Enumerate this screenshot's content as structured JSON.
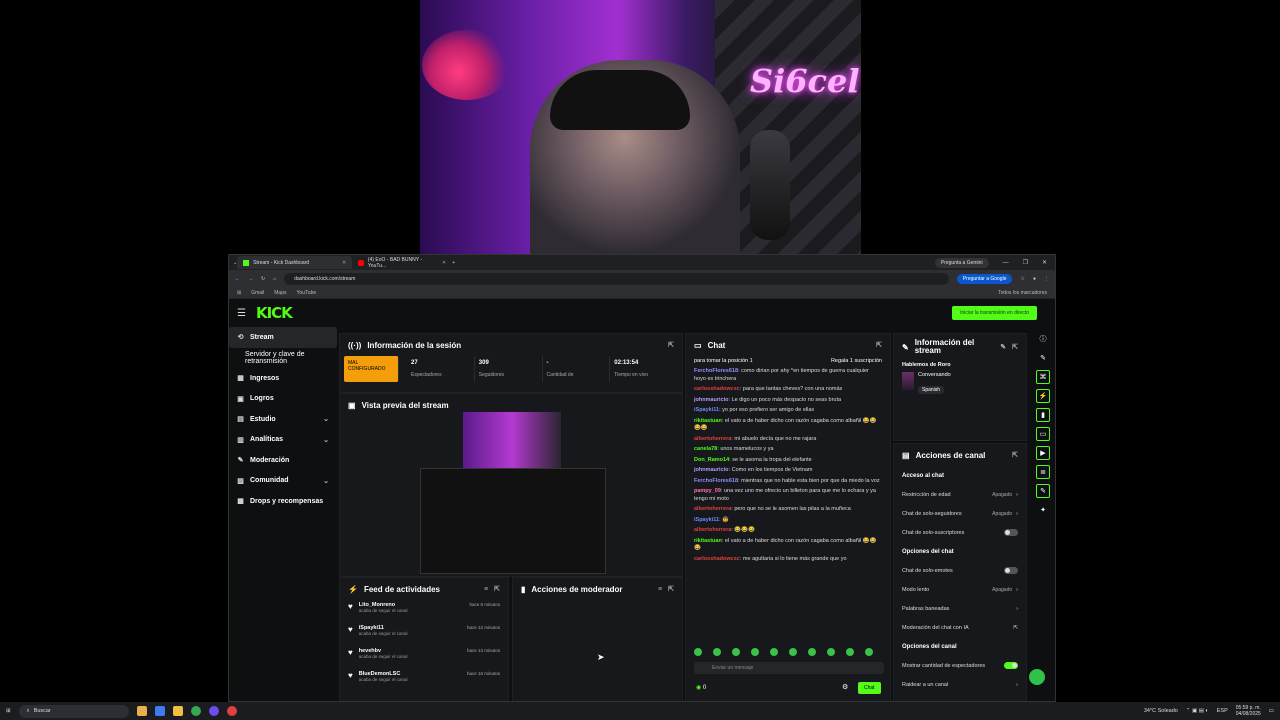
{
  "webcam": {
    "neon_sign": "Si6cel"
  },
  "browser": {
    "tabs": [
      {
        "label": "Stream - Kick Dashboard",
        "active": true
      },
      {
        "label": "(4) EoO - BAD BUNNY - YouTu...",
        "active": false
      }
    ],
    "gemini": "Pregunta a Gemini",
    "url": "dashboard.kick.com/stream",
    "google_btn": "Preguntar a Google",
    "bookmarks": [
      "Gmail",
      "Maps",
      "YouTube"
    ],
    "all_bookmarks": "Todos los marcadores"
  },
  "kick": {
    "logo": "KICK",
    "go_live": "Iniciar la transmisión en directo",
    "sidebar": [
      {
        "label": "Stream",
        "icon": "stream-icon"
      },
      {
        "label": "Servidor y clave de retransmisión",
        "icon": ""
      },
      {
        "label": "Ingresos",
        "icon": "income-icon"
      },
      {
        "label": "Logros",
        "icon": "trophy-icon"
      },
      {
        "label": "Estudio",
        "icon": "studio-icon"
      },
      {
        "label": "Analíticas",
        "icon": "analytics-icon"
      },
      {
        "label": "Moderación",
        "icon": "moderation-icon"
      },
      {
        "label": "Comunidad",
        "icon": "community-icon"
      },
      {
        "label": "Drops y recompensas",
        "icon": "drops-icon"
      }
    ],
    "session": {
      "title": "Información de la sesión",
      "warn": "MAL CONFIGURADO",
      "stats": [
        {
          "value": "27",
          "label": "Espectadores"
        },
        {
          "value": "309",
          "label": "Seguidores"
        },
        {
          "value": "-",
          "label": "Cantidad de"
        },
        {
          "value": "02:13:54",
          "label": "Tiempo en vivo"
        }
      ]
    },
    "preview": {
      "title": "Vista previa del stream"
    },
    "feed": {
      "title": "Feed de actividades",
      "items": [
        {
          "name": "Lito_Monreno",
          "sub": "acaba de seguir el canal",
          "time": "hace 5 minutos"
        },
        {
          "name": "iSpayki11",
          "sub": "acaba de seguir el canal",
          "time": "hace 12 minutos"
        },
        {
          "name": "hevehbv",
          "sub": "acaba de seguir el canal",
          "time": "hace 13 minutos"
        },
        {
          "name": "BlueDemonLSC",
          "sub": "acaba de seguir el canal",
          "time": "hace 16 minutos"
        }
      ]
    },
    "mod": {
      "title": "Acciones de moderador"
    },
    "chat": {
      "title": "Chat",
      "pinned": "para tomar la posición 1",
      "gift": "Regala 1 suscripción",
      "messages": [
        {
          "user": "FerchoFlores618",
          "color": "#8f8fff",
          "text": "como dirian por ahy *en tiempos de guerra cualquier hoyo es trinchera"
        },
        {
          "user": "carlosshadowcsc",
          "color": "#e04040",
          "text": "para que tantas cheves? con una nomás"
        },
        {
          "user": "johnmauricio",
          "color": "#b49bff",
          "text": "Le digo un poco más despacio no seas bruta"
        },
        {
          "user": "iSpayki11",
          "color": "#6a8cff",
          "text": "yo por eso prefiero ser amigo de ellas"
        },
        {
          "user": "rikitastuan",
          "color": "#53fc18",
          "text": "el vato a de haber dicho con razón cagaba como albañil 😂😂😂😂"
        },
        {
          "user": "albertoherrera",
          "color": "#e04040",
          "text": "mi abuelo decía que no me rajara"
        },
        {
          "user": "canela78",
          "color": "#53fc18",
          "text": "unos mamelucos y ya"
        },
        {
          "user": "Don_Ramo14",
          "color": "#53fc18",
          "text": "se le asoma la tropa del elefante"
        },
        {
          "user": "johnmauricio",
          "color": "#b49bff",
          "text": "Como en los tiempos de Vietnam"
        },
        {
          "user": "FerchoFlores618",
          "color": "#8f8fff",
          "text": "mientras que no hable esta bien por que da miedo la voz"
        },
        {
          "user": "pampy_09",
          "color": "#ff6fb5",
          "text": "una vez uno me ofrecio un billeton para que me lo echara y ya tengo mi moto"
        },
        {
          "user": "albertoherrera",
          "color": "#e04040",
          "text": "pero que no se le asomen las pilas a la muñeca"
        },
        {
          "user": "iSpayki11",
          "color": "#6a8cff",
          "text": "🤠"
        },
        {
          "user": "albertoherrera",
          "color": "#e04040",
          "text": "😂😂😂"
        },
        {
          "user": "rikitastuan",
          "color": "#53fc18",
          "text": "el vato a de haber dicho con razón cagaba como albañil 😂😂😂"
        },
        {
          "user": "carlosshadowcsc",
          "color": "#e04040",
          "text": "me agultaria si lo tiene más grande que yo"
        }
      ],
      "input_placeholder": "Enviar un mensaje",
      "count": "0",
      "send": "Chat"
    },
    "stream_info": {
      "title": "Información del stream",
      "stream_title": "Hablemos de Roro",
      "category": "Conversando",
      "language": "Spanish"
    },
    "actions": {
      "title": "Acciones de canal",
      "rows": [
        {
          "label": "Acceso al chat",
          "type": "header"
        },
        {
          "label": "Restricción de edad",
          "type": "value",
          "value": "Apagado"
        },
        {
          "label": "Chat de solo-seguidores",
          "type": "value",
          "value": "Apagado"
        },
        {
          "label": "Chat de solo-suscriptores",
          "type": "toggle",
          "on": false
        },
        {
          "label": "Opciones del chat",
          "type": "header"
        },
        {
          "label": "Chat de solo-emotes",
          "type": "toggle",
          "on": false
        },
        {
          "label": "Modo lento",
          "type": "value",
          "value": "Apagado"
        },
        {
          "label": "Palabras baneadas",
          "type": "value",
          "value": ""
        },
        {
          "label": "Moderación del chat con IA",
          "type": "link",
          "value": ""
        },
        {
          "label": "Opciones del canal",
          "type": "header"
        },
        {
          "label": "Mostrar cantidad de espectadores",
          "type": "toggle",
          "on": true
        },
        {
          "label": "Raidear a un canal",
          "type": "value",
          "value": ""
        }
      ]
    }
  },
  "taskbar": {
    "search": "Buscar",
    "weather": "34°C Soleado",
    "lang": "ESP",
    "time": "05:59 p. m.",
    "date": "04/08/2025"
  }
}
